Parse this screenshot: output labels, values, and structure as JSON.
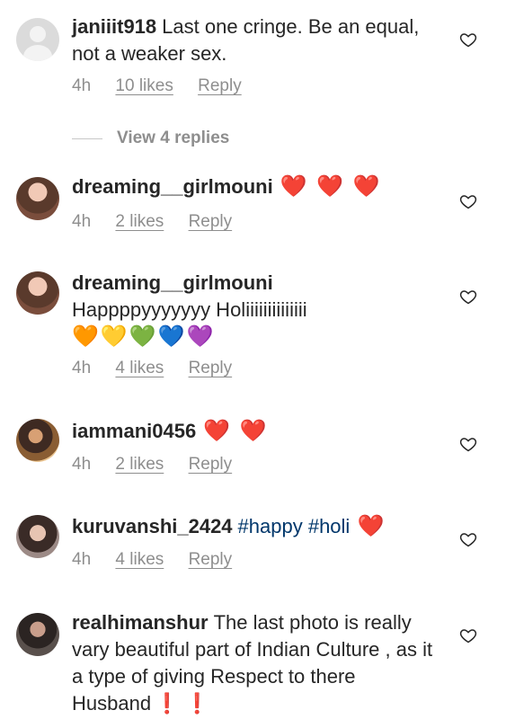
{
  "comments": [
    {
      "username": "janiiit918",
      "text": "Last one cringe. Be an equal, not a weaker sex.",
      "time": "4h",
      "likes": "10 likes",
      "reply": "Reply",
      "view_replies": "View 4 replies"
    },
    {
      "username": "dreaming__girlmouni",
      "text": "❤️ ❤️ ❤️",
      "time": "4h",
      "likes": "2 likes",
      "reply": "Reply"
    },
    {
      "username": "dreaming__girlmouni",
      "text": "Happppyyyyyyy Holiiiiiiiiiiiiii",
      "emoji_line": "🧡💛💚💙💜",
      "time": "4h",
      "likes": "4 likes",
      "reply": "Reply"
    },
    {
      "username": "iammani0456",
      "text": "❤️ ❤️",
      "time": "4h",
      "likes": "2 likes",
      "reply": "Reply"
    },
    {
      "username": "kuruvanshi_2424",
      "hashtags": "#happy #holi",
      "text": "❤️",
      "time": "4h",
      "likes": "4 likes",
      "reply": "Reply"
    },
    {
      "username": "realhimanshur",
      "text": "The last photo is really vary beautiful part of Indian Culture , as it a type of giving Respect to there Husband",
      "suffix": "❗ ❗"
    }
  ],
  "colors": {
    "text": "#262626",
    "muted": "#8e8e8e",
    "hashtag": "#00376b",
    "heart": "#e0242d"
  }
}
